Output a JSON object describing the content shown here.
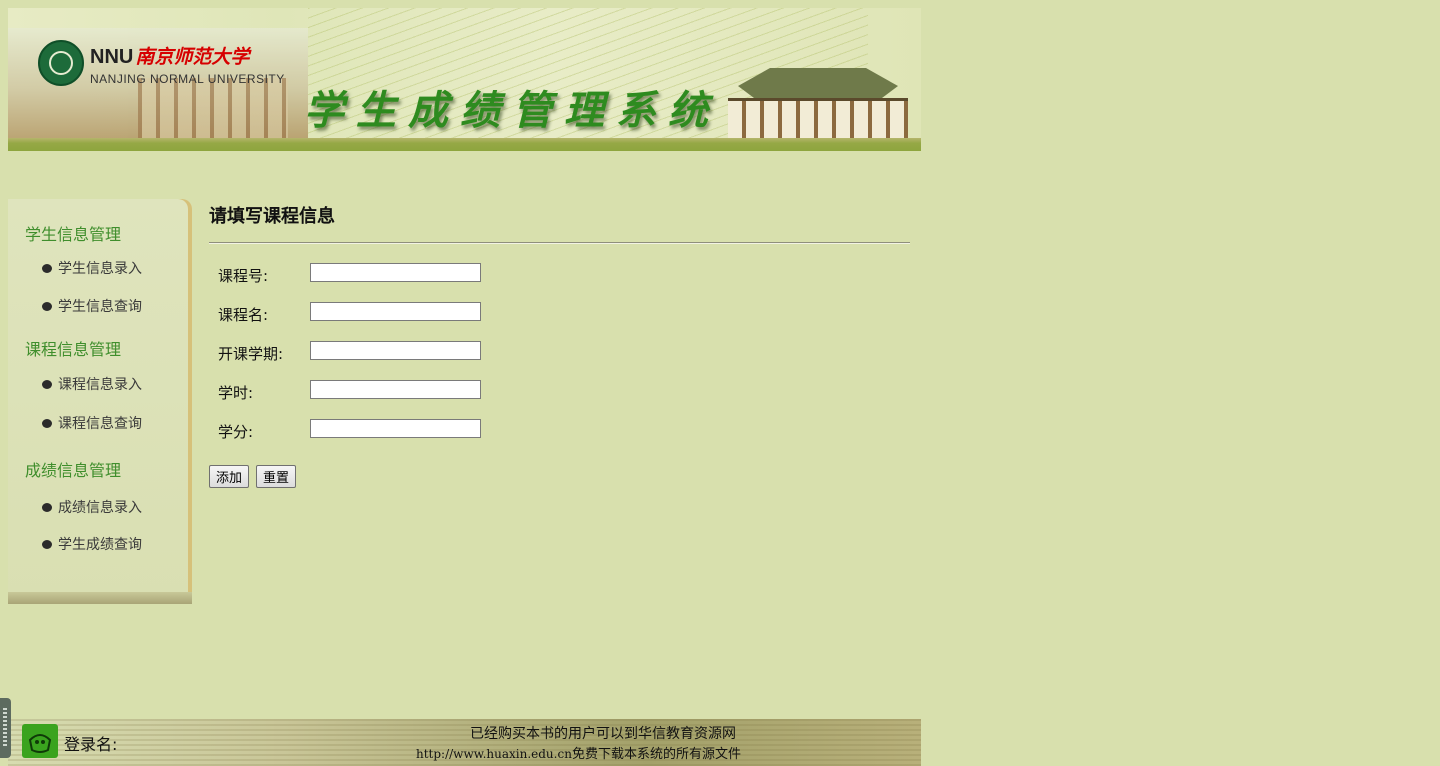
{
  "header": {
    "brand_short": "NNU",
    "brand_cn": "南京师范大学",
    "brand_en": "NANJING NORMAL UNIVERSITY",
    "system_title": "学生成绩管理系统"
  },
  "sidebar": {
    "sections": [
      {
        "label": "学生信息管理",
        "items": [
          "学生信息录入",
          "学生信息查询"
        ]
      },
      {
        "label": "课程信息管理",
        "items": [
          "课程信息录入",
          "课程信息查询"
        ]
      },
      {
        "label": "成绩信息管理",
        "items": [
          "成绩信息录入",
          "学生成绩查询"
        ]
      }
    ]
  },
  "main": {
    "title": "请填写课程信息",
    "fields": [
      {
        "label": "课程号:",
        "value": ""
      },
      {
        "label": "课程名:",
        "value": ""
      },
      {
        "label": "开课学期:",
        "value": ""
      },
      {
        "label": "学时:",
        "value": ""
      },
      {
        "label": "学分:",
        "value": ""
      }
    ],
    "buttons": {
      "add": "添加",
      "reset": "重置"
    }
  },
  "footer": {
    "login_label": "登录名:",
    "notice_line1": "已经购买本书的用户可以到华信教育资源网",
    "notice_url": "http://www.huaxin.edu.cn",
    "notice_line2_rest": "免费下载本系统的所有源文件"
  }
}
